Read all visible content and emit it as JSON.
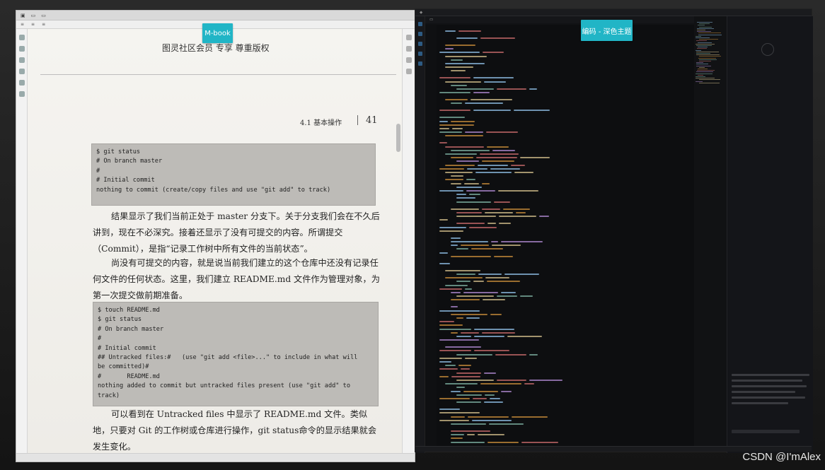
{
  "stickers": {
    "left": "M-book",
    "right": "编码 - 深色主题"
  },
  "reader": {
    "banner": "图灵社区会员  专享 尊重版权",
    "banner_fragment": "2 专享 尊重版权",
    "section": "4.1  基本操作",
    "page_number": "41",
    "code_block_1": "$ git status\n# On branch master\n#\n# Initial commit\nnothing to commit (create/copy files and use \"git add\" to track)",
    "paragraph_1": "结果显示了我们当前正处于 master 分支下。关于分支我们会在不久后讲到，现在不必深究。接着还显示了没有可提交的内容。所谓提交（Commit），是指“记录工作树中所有文件的当前状态”。",
    "paragraph_2": "尚没有可提交的内容，就是说当前我们建立的这个仓库中还没有记录任何文件的任何状态。这里，我们建立 README.md 文件作为管理对象，为第一次提交做前期准备。",
    "code_block_2": "$ touch README.md\n$ git status\n# On branch master\n#\n# Initial commit\n## Untracked files:#   (use \"git add <file>...\" to include in what will\nbe committed)#\n#       README.md\nnothing added to commit but untracked files present (use \"git add\" to\ntrack)",
    "paragraph_3": "可以看到在 Untracked files 中显示了 README.md 文件。类似地，只要对 Git 的工作树或仓库进行操作，git  status命令的显示结果就会发生变化。"
  },
  "watermark": "CSDN @I'mAlex"
}
